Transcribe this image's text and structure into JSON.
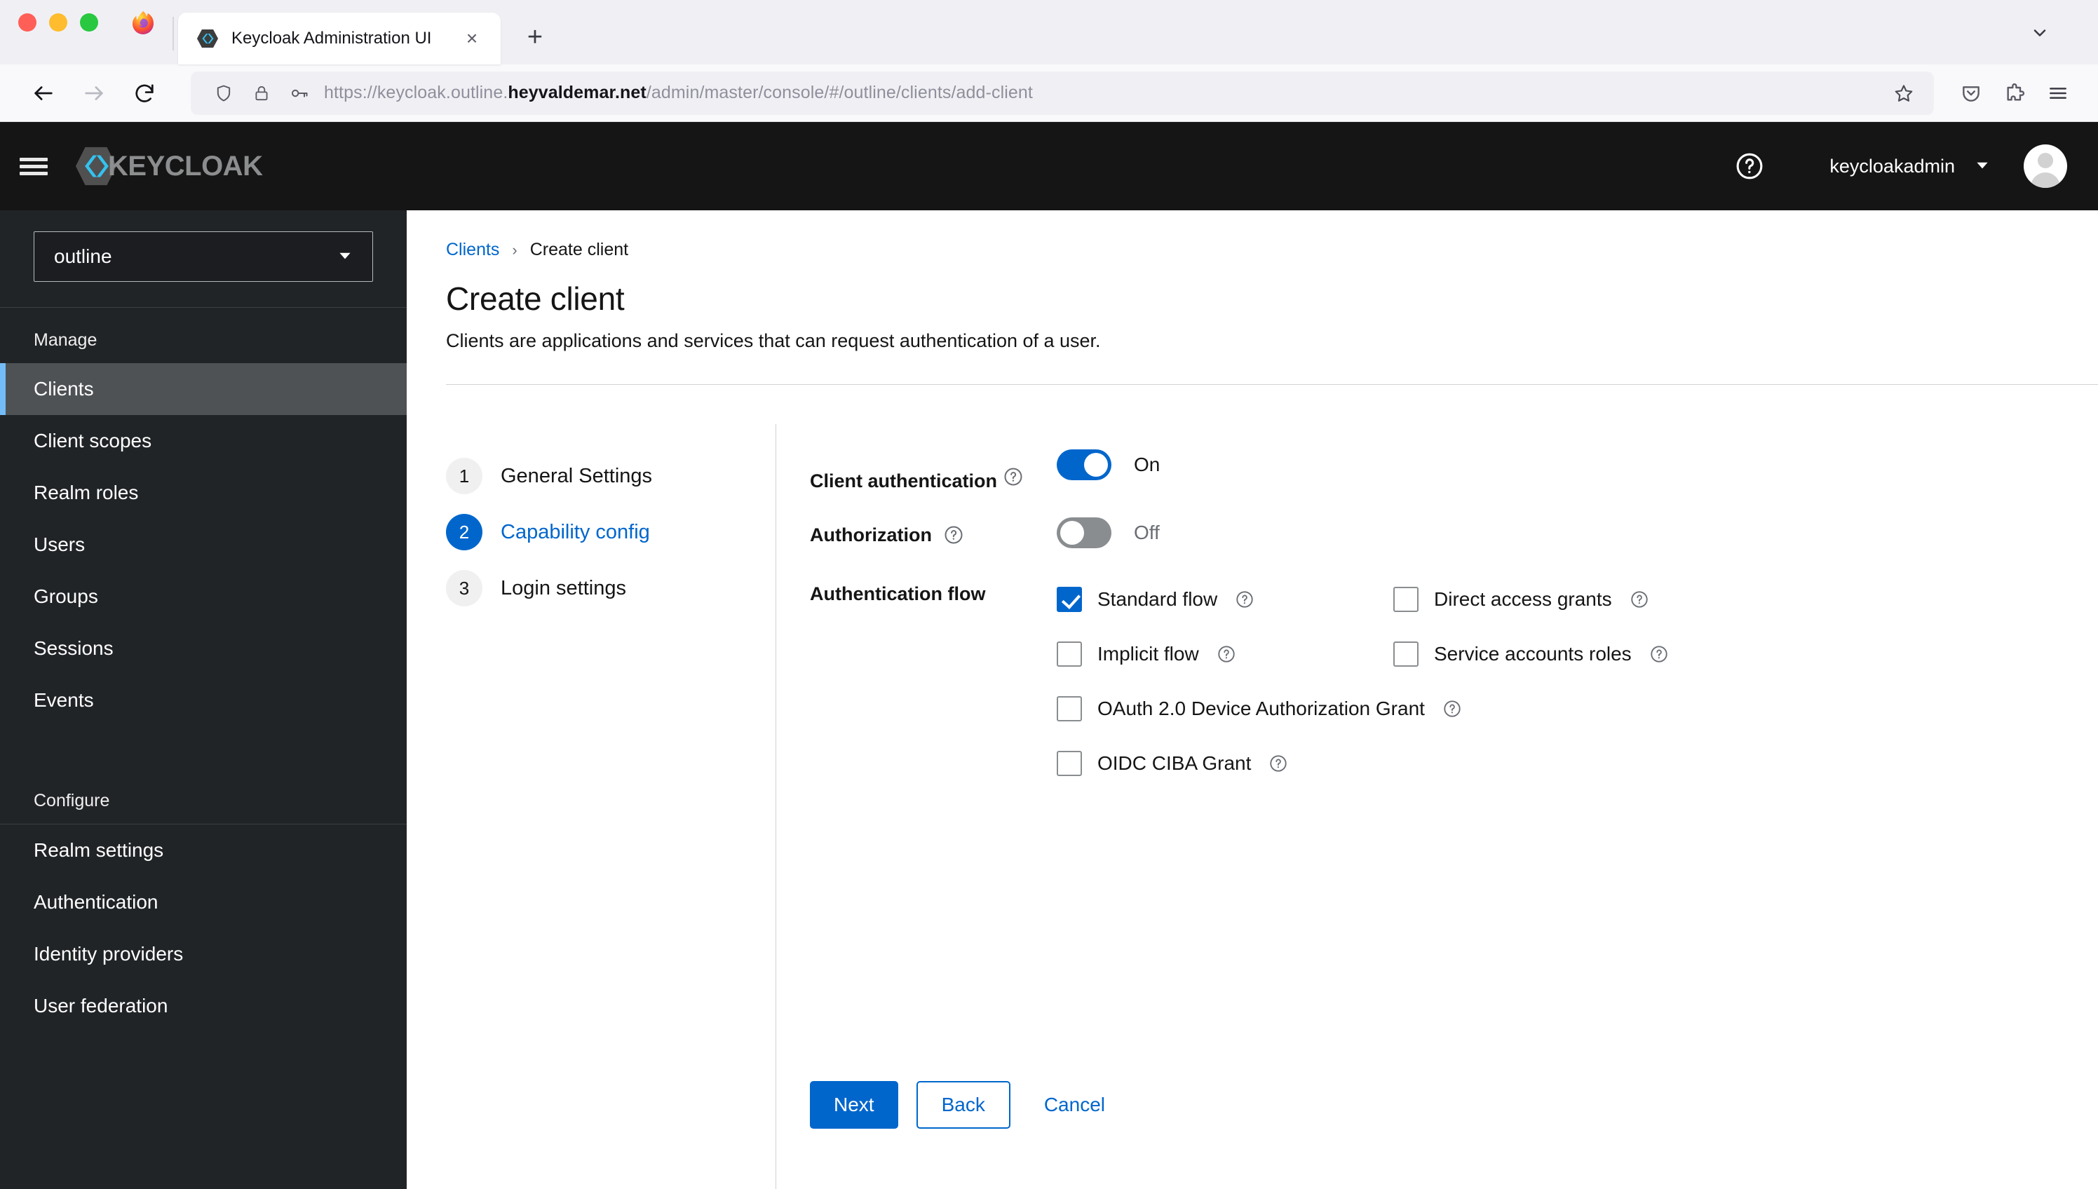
{
  "browser": {
    "tab": {
      "title": "Keycloak Administration UI",
      "favicon": "keycloak-favicon"
    },
    "new_tab_label": "+",
    "close_label": "×",
    "url": {
      "prefix": "https://keycloak.outline.",
      "domain_bold": "heyvaldemar.net",
      "suffix": "/admin/master/console/#/outline/clients/add-client"
    },
    "icons": {
      "back": "back-arrow-icon",
      "forward": "forward-arrow-icon",
      "reload": "reload-icon",
      "shield": "tracking-protection-shield-icon",
      "lock": "padlock-icon",
      "permissions": "key-icon",
      "bookmark": "bookmark-star-icon",
      "pocket": "save-to-pocket-icon",
      "extensions": "extensions-puzzle-icon",
      "app_menu": "hamburger-menu-icon",
      "tab_list": "list-all-tabs-chevron-icon"
    }
  },
  "masthead": {
    "brand": "KEYCLOAK",
    "menu_toggle": "global-nav-toggle",
    "help_icon": "help-question-icon",
    "username": "keycloakadmin",
    "caret": "▾",
    "avatar": "user-avatar"
  },
  "sidebar": {
    "realm": {
      "value": "outline",
      "caret": "▼"
    },
    "sections": [
      {
        "heading": "Manage",
        "items": [
          {
            "label": "Clients",
            "active": true
          },
          {
            "label": "Client scopes",
            "active": false
          },
          {
            "label": "Realm roles",
            "active": false
          },
          {
            "label": "Users",
            "active": false
          },
          {
            "label": "Groups",
            "active": false
          },
          {
            "label": "Sessions",
            "active": false
          },
          {
            "label": "Events",
            "active": false
          }
        ]
      },
      {
        "heading": "Configure",
        "items": [
          {
            "label": "Realm settings",
            "active": false
          },
          {
            "label": "Authentication",
            "active": false
          },
          {
            "label": "Identity providers",
            "active": false
          },
          {
            "label": "User federation",
            "active": false
          }
        ]
      }
    ]
  },
  "page": {
    "breadcrumb": {
      "parent": "Clients",
      "separator": "›",
      "current": "Create client"
    },
    "title": "Create client",
    "subtitle": "Clients are applications and services that can request authentication of a user."
  },
  "wizard": {
    "steps": [
      {
        "num": "1",
        "label": "General Settings",
        "active": false
      },
      {
        "num": "2",
        "label": "Capability config",
        "active": true
      },
      {
        "num": "3",
        "label": "Login settings",
        "active": false
      }
    ]
  },
  "form": {
    "client_authentication": {
      "label": "Client authentication",
      "state": "On",
      "on": true,
      "help": "help-question-icon"
    },
    "authorization": {
      "label": "Authorization",
      "state": "Off",
      "on": false,
      "help": "help-question-icon"
    },
    "authentication_flow": {
      "label": "Authentication flow",
      "options": [
        {
          "label": "Standard flow",
          "checked": true,
          "help": "help-question-icon"
        },
        {
          "label": "Direct access grants",
          "checked": false,
          "help": "help-question-icon"
        },
        {
          "label": "Implicit flow",
          "checked": false,
          "help": "help-question-icon"
        },
        {
          "label": "Service accounts roles",
          "checked": false,
          "help": "help-question-icon"
        },
        {
          "label": "OAuth 2.0 Device Authorization Grant",
          "checked": false,
          "help": "help-question-icon"
        },
        {
          "label": "OIDC CIBA Grant",
          "checked": false,
          "help": "help-question-icon"
        }
      ]
    },
    "buttons": {
      "next": "Next",
      "back": "Back",
      "cancel": "Cancel"
    }
  },
  "colors": {
    "accent_blue": "#0066cc",
    "masthead_black": "#151515",
    "sidebar_dark": "#212427",
    "sidebar_active": "#4f5255",
    "active_border": "#73bcf7",
    "toggle_off_gray": "#8a8d90"
  }
}
